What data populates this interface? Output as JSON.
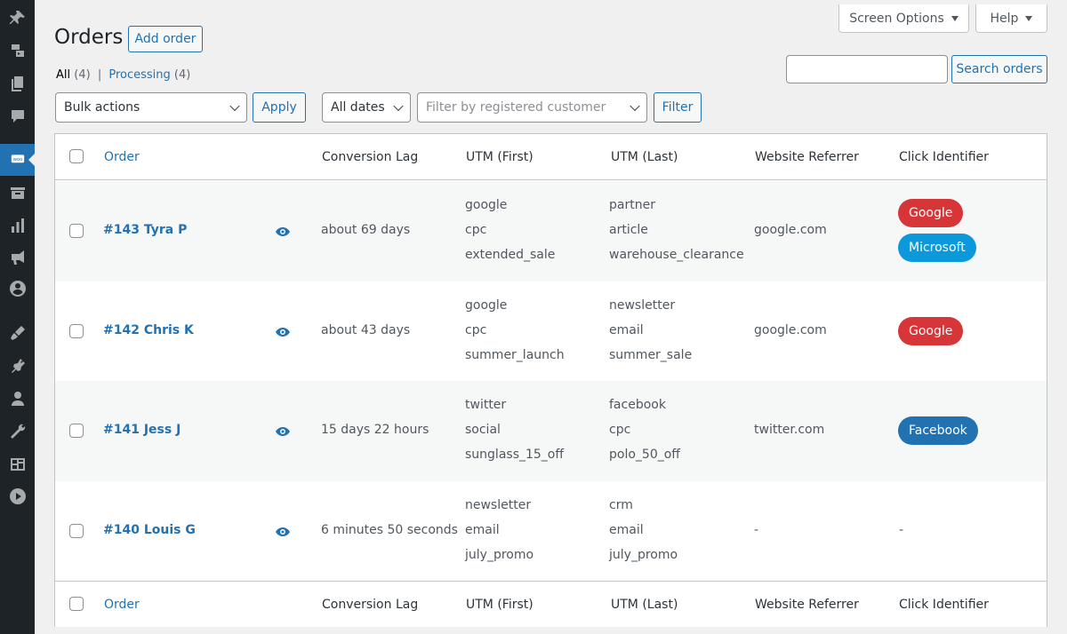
{
  "colors": {
    "accent": "#2271b1",
    "google": "#d63638",
    "microsoft": "#0b99dc",
    "facebook": "#2271b1"
  },
  "sidebar": {
    "icons": [
      "pin-icon",
      "media-icon",
      "pages-icon",
      "comments-icon",
      "woocommerce-icon",
      "products-icon",
      "analytics-icon",
      "marketing-icon",
      "profile-icon",
      "appearance-icon",
      "plugins-icon",
      "users-icon",
      "tools-icon",
      "settings-icon",
      "play-icon"
    ],
    "active": "woocommerce-icon",
    "woo_label": "woo"
  },
  "header": {
    "title": "Orders",
    "add_order": "Add order",
    "screen_options": "Screen Options",
    "help": "Help"
  },
  "views": {
    "all_label": "All",
    "all_count": "(4)",
    "separator": "|",
    "processing_label": "Processing",
    "processing_count": "(4)"
  },
  "search": {
    "value": "",
    "button": "Search orders"
  },
  "filters": {
    "bulk_actions": "Bulk actions",
    "apply": "Apply",
    "dates": "All dates",
    "customer_placeholder": "Filter by registered customer",
    "filter": "Filter"
  },
  "columns": [
    "Order",
    "Conversion Lag",
    "UTM (First)",
    "UTM (Last)",
    "Website Referrer",
    "Click Identifier"
  ],
  "orders": [
    {
      "order": "#143 Tyra P",
      "lag": "about 69 days",
      "utm_first": [
        "google",
        "cpc",
        "extended_sale"
      ],
      "utm_last": [
        "partner",
        "article",
        "warehouse_clearance"
      ],
      "referrer": "google.com",
      "clicks": [
        "Google",
        "Microsoft"
      ]
    },
    {
      "order": "#142 Chris K",
      "lag": "about 43 days",
      "utm_first": [
        "google",
        "cpc",
        "summer_launch"
      ],
      "utm_last": [
        "newsletter",
        "email",
        "summer_sale"
      ],
      "referrer": "google.com",
      "clicks": [
        "Google"
      ]
    },
    {
      "order": "#141 Jess J",
      "lag": "15 days 22 hours",
      "utm_first": [
        "twitter",
        "social",
        "sunglass_15_off"
      ],
      "utm_last": [
        "facebook",
        "cpc",
        "polo_50_off"
      ],
      "referrer": "twitter.com",
      "clicks": [
        "Facebook"
      ]
    },
    {
      "order": "#140 Louis G",
      "lag": "6 minutes 50 seconds",
      "utm_first": [
        "newsletter",
        "email",
        "july_promo"
      ],
      "utm_last": [
        "crm",
        "email",
        "july_promo"
      ],
      "referrer": "-",
      "clicks_empty": "-"
    }
  ]
}
